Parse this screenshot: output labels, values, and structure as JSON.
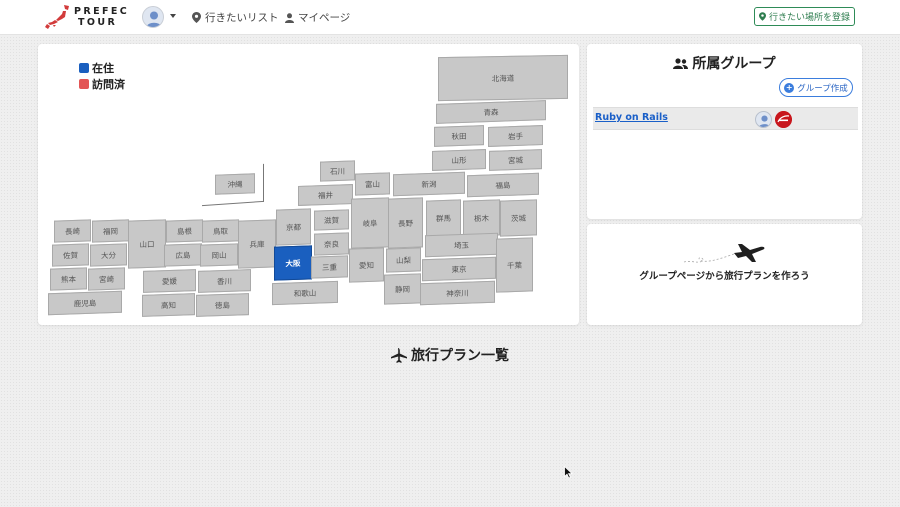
{
  "header": {
    "logo_line1": "PREFEC",
    "logo_line2": "TOUR",
    "nav_wishlist": "行きたいリスト",
    "nav_mypage": "マイページ",
    "register_button": "行きたい場所を登録"
  },
  "legend": {
    "live": "在住",
    "visited": "訪問済"
  },
  "colors": {
    "live": "#1a5fbf",
    "visited": "#e35555",
    "default_pref": "#c8c8c8",
    "accent": "#2e8b57"
  },
  "map": {
    "prefectures": [
      {
        "name": "北海道",
        "status": "none"
      },
      {
        "name": "青森",
        "status": "none"
      },
      {
        "name": "秋田",
        "status": "none"
      },
      {
        "name": "岩手",
        "status": "none"
      },
      {
        "name": "山形",
        "status": "none"
      },
      {
        "name": "宮城",
        "status": "none"
      },
      {
        "name": "石川",
        "status": "none"
      },
      {
        "name": "富山",
        "status": "none"
      },
      {
        "name": "新潟",
        "status": "none"
      },
      {
        "name": "福島",
        "status": "none"
      },
      {
        "name": "福井",
        "status": "none"
      },
      {
        "name": "沖縄",
        "status": "none"
      },
      {
        "name": "京都",
        "status": "none"
      },
      {
        "name": "滋賀",
        "status": "none"
      },
      {
        "name": "岐阜",
        "status": "none"
      },
      {
        "name": "長野",
        "status": "none"
      },
      {
        "name": "群馬",
        "status": "none"
      },
      {
        "name": "栃木",
        "status": "none"
      },
      {
        "name": "茨城",
        "status": "none"
      },
      {
        "name": "長崎",
        "status": "none"
      },
      {
        "name": "福岡",
        "status": "none"
      },
      {
        "name": "山口",
        "status": "none"
      },
      {
        "name": "島根",
        "status": "none"
      },
      {
        "name": "鳥取",
        "status": "none"
      },
      {
        "name": "兵庫",
        "status": "none"
      },
      {
        "name": "奈良",
        "status": "none"
      },
      {
        "name": "埼玉",
        "status": "none"
      },
      {
        "name": "佐賀",
        "status": "none"
      },
      {
        "name": "大分",
        "status": "none"
      },
      {
        "name": "広島",
        "status": "none"
      },
      {
        "name": "岡山",
        "status": "none"
      },
      {
        "name": "大阪",
        "status": "live"
      },
      {
        "name": "三重",
        "status": "none"
      },
      {
        "name": "愛知",
        "status": "none"
      },
      {
        "name": "山梨",
        "status": "none"
      },
      {
        "name": "東京",
        "status": "none"
      },
      {
        "name": "千葉",
        "status": "none"
      },
      {
        "name": "熊本",
        "status": "none"
      },
      {
        "name": "宮崎",
        "status": "none"
      },
      {
        "name": "愛媛",
        "status": "none"
      },
      {
        "name": "香川",
        "status": "none"
      },
      {
        "name": "静岡",
        "status": "none"
      },
      {
        "name": "神奈川",
        "status": "none"
      },
      {
        "name": "鹿児島",
        "status": "none"
      },
      {
        "name": "高知",
        "status": "none"
      },
      {
        "name": "徳島",
        "status": "none"
      },
      {
        "name": "和歌山",
        "status": "none"
      }
    ]
  },
  "groups": {
    "title": "所属グループ",
    "create_button": "グループ作成",
    "items": [
      {
        "name": "Ruby on Rails"
      }
    ]
  },
  "cta": {
    "text": "グループページから旅行プランを作ろう"
  },
  "plans": {
    "heading": "旅行プラン一覧"
  }
}
